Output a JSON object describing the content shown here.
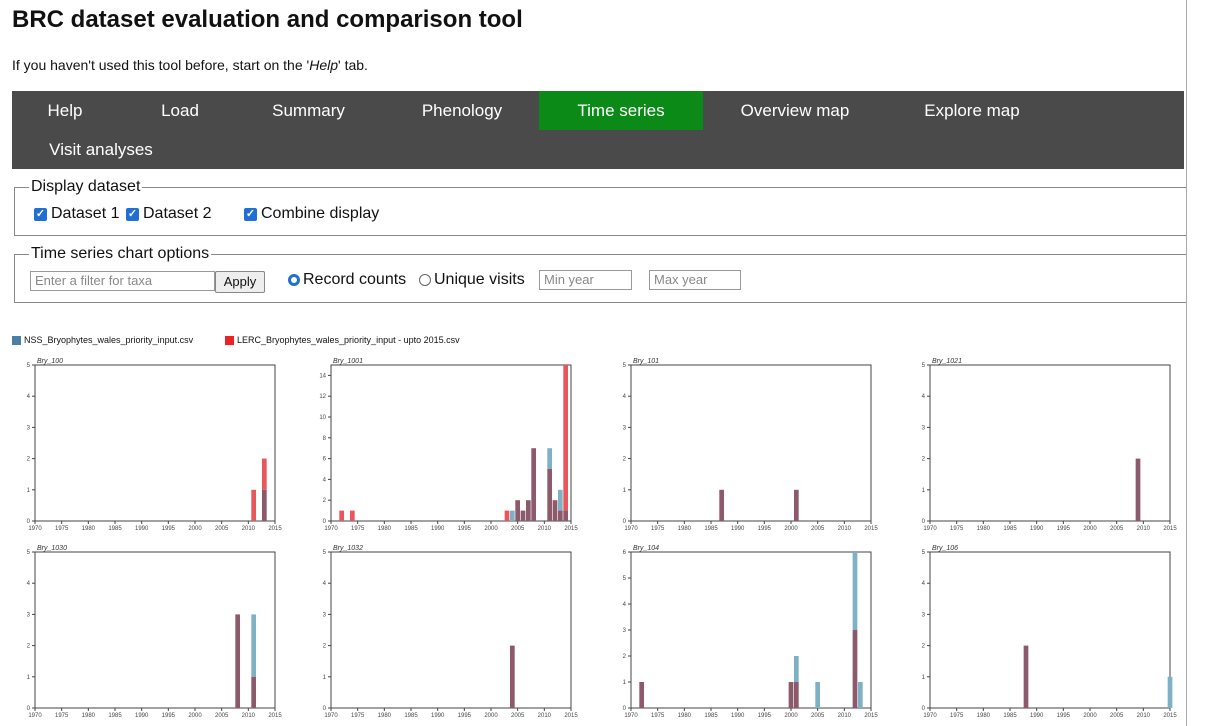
{
  "title": "BRC dataset evaluation and comparison tool",
  "intro": {
    "pre": "If you haven't used this tool before, start on the '",
    "em": "Help",
    "post": "' tab."
  },
  "tabs": [
    {
      "label": "Help",
      "active": false
    },
    {
      "label": "Load",
      "active": false
    },
    {
      "label": "Summary",
      "active": false
    },
    {
      "label": "Phenology",
      "active": false
    },
    {
      "label": "Time series",
      "active": true
    },
    {
      "label": "Overview map",
      "active": false
    },
    {
      "label": "Explore map",
      "active": false
    },
    {
      "label": "Visit analyses",
      "active": false
    }
  ],
  "display": {
    "legend": "Display dataset",
    "dataset1": {
      "label": "Dataset 1",
      "checked": true
    },
    "dataset2": {
      "label": "Dataset 2",
      "checked": true
    },
    "combine": {
      "label": "Combine display",
      "checked": true
    }
  },
  "options": {
    "legend": "Time series chart options",
    "filter_placeholder": "Enter a filter for taxa",
    "apply_label": "Apply",
    "record_counts_label": "Record counts",
    "unique_visits_label": "Unique visits",
    "selected_metric": "Record counts",
    "min_year_placeholder": "Min year",
    "max_year_placeholder": "Max year"
  },
  "chart_legend": {
    "series1": "NSS_Bryophytes_wales_priority_input.csv",
    "series2": "LERC_Bryophytes_wales_priority_input - upto 2015.csv"
  },
  "colors": {
    "series1": "#7fb1c6",
    "series2": "#e8575b",
    "overlap": "#8c5a6a",
    "legend1": "#4a7fa8",
    "legend2": "#ee2222",
    "active_tab": "#0b8a17",
    "nav_bg": "#4a4a4a"
  },
  "chart_data": [
    {
      "type": "bar",
      "title": "Bry_100",
      "ylim": [
        0,
        5
      ],
      "xlim": [
        1970,
        2015
      ],
      "x_ticks": [
        1970,
        1975,
        1980,
        1985,
        1990,
        1995,
        2000,
        2005,
        2010,
        2015
      ],
      "series": [
        {
          "name": "NSS_Bryophytes_wales_priority_input.csv",
          "x": [
            2013
          ],
          "values": [
            1
          ]
        },
        {
          "name": "LERC_Bryophytes_wales_priority_input - upto 2015.csv",
          "x": [
            2011,
            2013
          ],
          "values": [
            1,
            2
          ]
        }
      ]
    },
    {
      "type": "bar",
      "title": "Bry_1001",
      "ylim": [
        0,
        15
      ],
      "xlim": [
        1970,
        2015
      ],
      "y_ticks": [
        0,
        2,
        4,
        6,
        8,
        10,
        12,
        14
      ],
      "x_ticks": [
        1970,
        1975,
        1980,
        1985,
        1990,
        1995,
        2000,
        2005,
        2010,
        2015
      ],
      "series": [
        {
          "name": "NSS_Bryophytes_wales_priority_input.csv",
          "x": [
            2004,
            2005,
            2006,
            2007,
            2008,
            2011,
            2012,
            2013,
            2014
          ],
          "values": [
            1,
            2,
            1,
            2,
            7,
            7,
            2,
            3,
            1
          ]
        },
        {
          "name": "LERC_Bryophytes_wales_priority_input - upto 2015.csv",
          "x": [
            1972,
            1974,
            2003,
            2005,
            2006,
            2007,
            2008,
            2011,
            2012,
            2013,
            2014
          ],
          "values": [
            1,
            1,
            1,
            2,
            1,
            2,
            7,
            5,
            2,
            1,
            15
          ]
        }
      ]
    },
    {
      "type": "bar",
      "title": "Bry_101",
      "ylim": [
        0,
        5
      ],
      "xlim": [
        1970,
        2015
      ],
      "x_ticks": [
        1970,
        1975,
        1980,
        1985,
        1990,
        1995,
        2000,
        2005,
        2010,
        2015
      ],
      "series": [
        {
          "name": "NSS_Bryophytes_wales_priority_input.csv",
          "x": [
            1987,
            2001
          ],
          "values": [
            1,
            1
          ]
        },
        {
          "name": "LERC_Bryophytes_wales_priority_input - upto 2015.csv",
          "x": [
            1987,
            2001
          ],
          "values": [
            1,
            1
          ]
        }
      ]
    },
    {
      "type": "bar",
      "title": "Bry_1021",
      "ylim": [
        0,
        5
      ],
      "xlim": [
        1970,
        2015
      ],
      "x_ticks": [
        1970,
        1975,
        1980,
        1985,
        1990,
        1995,
        2000,
        2005,
        2010,
        2015
      ],
      "series": [
        {
          "name": "NSS_Bryophytes_wales_priority_input.csv",
          "x": [
            2009
          ],
          "values": [
            2
          ]
        },
        {
          "name": "LERC_Bryophytes_wales_priority_input - upto 2015.csv",
          "x": [
            2009
          ],
          "values": [
            2
          ]
        }
      ]
    },
    {
      "type": "bar",
      "title": "Bry_1030",
      "ylim": [
        0,
        5
      ],
      "xlim": [
        1970,
        2015
      ],
      "x_ticks": [
        1970,
        1975,
        1980,
        1985,
        1990,
        1995,
        2000,
        2005,
        2010,
        2015
      ],
      "series": [
        {
          "name": "NSS_Bryophytes_wales_priority_input.csv",
          "x": [
            2008,
            2011
          ],
          "values": [
            3,
            3
          ]
        },
        {
          "name": "LERC_Bryophytes_wales_priority_input - upto 2015.csv",
          "x": [
            2008,
            2011
          ],
          "values": [
            3,
            1
          ]
        }
      ]
    },
    {
      "type": "bar",
      "title": "Bry_1032",
      "ylim": [
        0,
        5
      ],
      "xlim": [
        1970,
        2015
      ],
      "x_ticks": [
        1970,
        1975,
        1980,
        1985,
        1990,
        1995,
        2000,
        2005,
        2010,
        2015
      ],
      "series": [
        {
          "name": "NSS_Bryophytes_wales_priority_input.csv",
          "x": [
            2004
          ],
          "values": [
            2
          ]
        },
        {
          "name": "LERC_Bryophytes_wales_priority_input - upto 2015.csv",
          "x": [
            2004
          ],
          "values": [
            2
          ]
        }
      ]
    },
    {
      "type": "bar",
      "title": "Bry_104",
      "ylim": [
        0,
        6
      ],
      "xlim": [
        1970,
        2015
      ],
      "x_ticks": [
        1970,
        1975,
        1980,
        1985,
        1990,
        1995,
        2000,
        2005,
        2010,
        2015
      ],
      "series": [
        {
          "name": "NSS_Bryophytes_wales_priority_input.csv",
          "x": [
            1972,
            2000,
            2001,
            2005,
            2012,
            2013
          ],
          "values": [
            1,
            1,
            2,
            1,
            6,
            1
          ]
        },
        {
          "name": "LERC_Bryophytes_wales_priority_input - upto 2015.csv",
          "x": [
            1972,
            2000,
            2001,
            2012
          ],
          "values": [
            1,
            1,
            1,
            3
          ]
        }
      ]
    },
    {
      "type": "bar",
      "title": "Bry_106",
      "ylim": [
        0,
        5
      ],
      "xlim": [
        1970,
        2015
      ],
      "x_ticks": [
        1970,
        1975,
        1980,
        1985,
        1990,
        1995,
        2000,
        2005,
        2010,
        2015
      ],
      "series": [
        {
          "name": "NSS_Bryophytes_wales_priority_input.csv",
          "x": [
            1988,
            2015
          ],
          "values": [
            2,
            1
          ]
        },
        {
          "name": "LERC_Bryophytes_wales_priority_input - upto 2015.csv",
          "x": [
            1988
          ],
          "values": [
            2
          ]
        }
      ]
    }
  ]
}
